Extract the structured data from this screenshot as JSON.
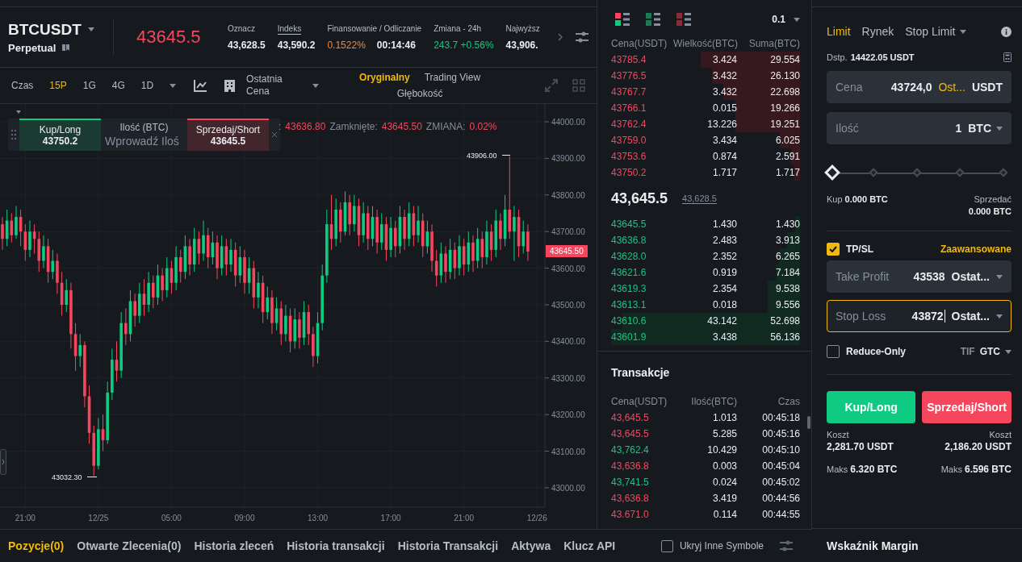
{
  "header": {
    "symbol": "BTCUSDT",
    "contract": "Perpetual",
    "last_price": "43645.5",
    "stats": [
      {
        "label": "Oznacz",
        "underlined": false,
        "values": [
          {
            "text": "43,628.5",
            "kind": "plain"
          }
        ]
      },
      {
        "label": "Indeks",
        "underlined": true,
        "values": [
          {
            "text": "43,590.2",
            "kind": "plain"
          }
        ]
      },
      {
        "label": "Finansowanie / Odliczanie",
        "underlined": false,
        "values": [
          {
            "text": "0.1522%",
            "kind": "rate"
          },
          {
            "text": "00:14:46",
            "kind": "plain"
          }
        ]
      },
      {
        "label": "Zmiana - 24h",
        "underlined": false,
        "values": [
          {
            "text": "243.7 +0.56%",
            "kind": "up"
          }
        ]
      },
      {
        "label": "Najwyższ",
        "underlined": false,
        "values": [
          {
            "text": "43,906.",
            "kind": "plain"
          }
        ]
      }
    ]
  },
  "toolbar": {
    "label": "Czas",
    "intervals": [
      {
        "label": "15P",
        "selected": true
      },
      {
        "label": "1G",
        "selected": false
      },
      {
        "label": "4G",
        "selected": false
      },
      {
        "label": "1D",
        "selected": false
      }
    ],
    "price_source": "Ostatnia Cena",
    "views": [
      {
        "label": "Oryginalny",
        "selected": true
      },
      {
        "label": "Trading View",
        "selected": false
      },
      {
        "label": "Głębokość",
        "selected": false
      }
    ]
  },
  "chart": {
    "chart_data": {
      "type": "candlestick",
      "categories": [
        null,
        null,
        null,
        null,
        null,
        "21:00",
        null,
        null,
        null,
        null,
        null,
        null,
        null,
        null,
        null,
        null,
        null,
        null,
        null,
        null,
        null,
        "12/25",
        null,
        null,
        null,
        null,
        null,
        null,
        null,
        null,
        null,
        null,
        null,
        null,
        null,
        null,
        null,
        "05:00",
        null,
        null,
        null,
        null,
        null,
        null,
        null,
        null,
        null,
        null,
        null,
        null,
        null,
        null,
        null,
        "09:00",
        null,
        null,
        null,
        null,
        null,
        null,
        null,
        null,
        null,
        null,
        null,
        null,
        null,
        null,
        null,
        "13:00",
        null,
        null,
        null,
        null,
        null,
        null,
        null,
        null,
        null,
        null,
        null,
        null,
        null,
        null,
        null,
        "17:00",
        null,
        null,
        null,
        null,
        null,
        null,
        null,
        null,
        null,
        null,
        null,
        null,
        null,
        null,
        null,
        "21:00",
        null,
        null,
        null,
        null,
        null,
        null,
        null,
        null,
        null,
        null,
        null,
        null,
        null,
        null,
        null,
        "12/26"
      ],
      "ohlc": [
        [
          43720,
          43740,
          43650,
          43680
        ],
        [
          43680,
          43760,
          43660,
          43730
        ],
        [
          43730,
          43750,
          43670,
          43690
        ],
        [
          43690,
          43770,
          43680,
          43740
        ],
        [
          43740,
          43760,
          43660,
          43700
        ],
        [
          43700,
          43720,
          43620,
          43650
        ],
        [
          43650,
          43730,
          43630,
          43700
        ],
        [
          43700,
          43720,
          43640,
          43680
        ],
        [
          43680,
          43700,
          43590,
          43620
        ],
        [
          43620,
          43690,
          43600,
          43660
        ],
        [
          43660,
          43680,
          43560,
          43590
        ],
        [
          43590,
          43650,
          43570,
          43620
        ],
        [
          43620,
          43640,
          43530,
          43560
        ],
        [
          43560,
          43590,
          43470,
          43500
        ],
        [
          43500,
          43570,
          43480,
          43540
        ],
        [
          43540,
          43560,
          43380,
          43420
        ],
        [
          43420,
          43450,
          43320,
          43360
        ],
        [
          43360,
          43420,
          43330,
          43390
        ],
        [
          43390,
          43400,
          43220,
          43250
        ],
        [
          43250,
          43280,
          43120,
          43150
        ],
        [
          43150,
          43170,
          43032.3,
          43060
        ],
        [
          43060,
          43190,
          43050,
          43160
        ],
        [
          43160,
          43200,
          43100,
          43130
        ],
        [
          43130,
          43290,
          43120,
          43260
        ],
        [
          43260,
          43380,
          43240,
          43350
        ],
        [
          43350,
          43400,
          43290,
          43320
        ],
        [
          43320,
          43480,
          43300,
          43450
        ],
        [
          43450,
          43490,
          43390,
          43420
        ],
        [
          43420,
          43540,
          43400,
          43510
        ],
        [
          43510,
          43530,
          43440,
          43470
        ],
        [
          43470,
          43560,
          43450,
          43530
        ],
        [
          43530,
          43570,
          43470,
          43500
        ],
        [
          43500,
          43590,
          43480,
          43560
        ],
        [
          43560,
          43580,
          43490,
          43520
        ],
        [
          43520,
          43610,
          43500,
          43580
        ],
        [
          43580,
          43600,
          43510,
          43540
        ],
        [
          43540,
          43630,
          43520,
          43600
        ],
        [
          43600,
          43620,
          43530,
          43560
        ],
        [
          43560,
          43660,
          43540,
          43630
        ],
        [
          43630,
          43650,
          43560,
          43590
        ],
        [
          43590,
          43690,
          43570,
          43660
        ],
        [
          43660,
          43680,
          43580,
          43610
        ],
        [
          43610,
          43710,
          43590,
          43680
        ],
        [
          43680,
          43700,
          43610,
          43640
        ],
        [
          43640,
          43730,
          43620,
          43690
        ],
        [
          43690,
          43710,
          43600,
          43630
        ],
        [
          43630,
          43700,
          43610,
          43670
        ],
        [
          43670,
          43690,
          43570,
          43600
        ],
        [
          43600,
          43690,
          43580,
          43660
        ],
        [
          43660,
          43680,
          43580,
          43610
        ],
        [
          43610,
          43680,
          43590,
          43650
        ],
        [
          43650,
          43670,
          43550,
          43580
        ],
        [
          43580,
          43660,
          43560,
          43630
        ],
        [
          43630,
          43650,
          43530,
          43560
        ],
        [
          43560,
          43630,
          43530,
          43600
        ],
        [
          43600,
          43620,
          43490,
          43520
        ],
        [
          43520,
          43590,
          43490,
          43560
        ],
        [
          43560,
          43580,
          43450,
          43480
        ],
        [
          43480,
          43550,
          43460,
          43520
        ],
        [
          43520,
          43540,
          43420,
          43450
        ],
        [
          43450,
          43520,
          43430,
          43490
        ],
        [
          43490,
          43510,
          43390,
          43420
        ],
        [
          43420,
          43500,
          43400,
          43470
        ],
        [
          43470,
          43490,
          43370,
          43400
        ],
        [
          43400,
          43490,
          43380,
          43460
        ],
        [
          43460,
          43480,
          43380,
          43410
        ],
        [
          43410,
          43510,
          43390,
          43480
        ],
        [
          43480,
          43500,
          43390,
          43420
        ],
        [
          43420,
          43440,
          43330,
          43360
        ],
        [
          43360,
          43480,
          43340,
          43450
        ],
        [
          43450,
          43610,
          43430,
          43580
        ],
        [
          43580,
          43760,
          43560,
          43720
        ],
        [
          43720,
          43800,
          43650,
          43680
        ],
        [
          43680,
          43790,
          43660,
          43760
        ],
        [
          43760,
          43780,
          43670,
          43700
        ],
        [
          43700,
          43810,
          43690,
          43780
        ],
        [
          43780,
          43800,
          43690,
          43720
        ],
        [
          43720,
          43800,
          43700,
          43770
        ],
        [
          43770,
          43790,
          43660,
          43690
        ],
        [
          43690,
          43780,
          43670,
          43750
        ],
        [
          43750,
          43770,
          43650,
          43680
        ],
        [
          43680,
          43770,
          43660,
          43740
        ],
        [
          43740,
          43760,
          43640,
          43670
        ],
        [
          43670,
          43750,
          43650,
          43720
        ],
        [
          43720,
          43740,
          43620,
          43650
        ],
        [
          43650,
          43740,
          43630,
          43710
        ],
        [
          43710,
          43730,
          43630,
          43660
        ],
        [
          43660,
          43770,
          43640,
          43740
        ],
        [
          43740,
          43760,
          43650,
          43680
        ],
        [
          43680,
          43780,
          43660,
          43750
        ],
        [
          43750,
          43770,
          43660,
          43690
        ],
        [
          43690,
          43770,
          43670,
          43730
        ],
        [
          43730,
          43750,
          43630,
          43660
        ],
        [
          43660,
          43730,
          43640,
          43700
        ],
        [
          43700,
          43720,
          43590,
          43620
        ],
        [
          43620,
          43650,
          43550,
          43580
        ],
        [
          43580,
          43670,
          43560,
          43640
        ],
        [
          43640,
          43660,
          43560,
          43590
        ],
        [
          43590,
          43680,
          43570,
          43650
        ],
        [
          43650,
          43670,
          43570,
          43600
        ],
        [
          43600,
          43690,
          43580,
          43660
        ],
        [
          43660,
          43680,
          43580,
          43610
        ],
        [
          43610,
          43700,
          43590,
          43670
        ],
        [
          43670,
          43690,
          43590,
          43620
        ],
        [
          43620,
          43710,
          43600,
          43680
        ],
        [
          43680,
          43700,
          43600,
          43630
        ],
        [
          43630,
          43730,
          43610,
          43700
        ],
        [
          43700,
          43720,
          43620,
          43650
        ],
        [
          43650,
          43760,
          43630,
          43730
        ],
        [
          43730,
          43750,
          43650,
          43680
        ],
        [
          43680,
          43800,
          43660,
          43760
        ],
        [
          43760,
          43906,
          43680,
          43700
        ],
        [
          43700,
          43770,
          43620,
          43740
        ],
        [
          43740,
          43760,
          43630,
          43660
        ],
        [
          43660,
          43730,
          43640,
          43700
        ],
        [
          43700,
          43720,
          43620,
          43645.5
        ],
        null,
        null
      ],
      "ylim": [
        42947,
        44048.5
      ],
      "grid": true,
      "yticks": [
        {
          "value": 44000,
          "label": "44000.00"
        },
        {
          "value": 43900,
          "label": "43900.00"
        },
        {
          "value": 43800,
          "label": "43800.00"
        },
        {
          "value": 43700,
          "label": "43700.00"
        },
        {
          "value": 43600,
          "label": "43600.00"
        },
        {
          "value": 43500,
          "label": "43500.00"
        },
        {
          "value": 43400,
          "label": "43400.00"
        },
        {
          "value": 43300,
          "label": "43300.00"
        },
        {
          "value": 43200,
          "label": "43200.00"
        },
        {
          "value": 43100,
          "label": "43100.00"
        },
        {
          "value": 43000,
          "label": "43000.00"
        }
      ]
    },
    "current_price": "43645.50",
    "high_marker": "43906.00",
    "low_marker": "43032.30",
    "quick_trade": {
      "buy_label": "Kup/Long",
      "buy_price": "43750.2",
      "qty_label": "Ilość (BTC)",
      "qty_placeholder": "Wprowadź Iloś",
      "sell_label": "Sprzedaj/Short",
      "sell_price": "43645.5"
    },
    "ohlc": [
      {
        "label": ":",
        "value": "43636.80"
      },
      {
        "label": "Zamknięte:",
        "value": "43645.50"
      },
      {
        "label": "ZMIANA:",
        "value": "0.02%"
      }
    ]
  },
  "order_book": {
    "precision": "0.1",
    "columns": [
      "Cena(USDT)",
      "Wielkość(BTC)",
      "Suma(BTC)"
    ],
    "asks": [
      {
        "price": "43785.4",
        "size": "3.424",
        "sum": "29.554"
      },
      {
        "price": "43776.5",
        "size": "3.432",
        "sum": "26.130"
      },
      {
        "price": "43767.7",
        "size": "3.432",
        "sum": "22.698"
      },
      {
        "price": "43766.1",
        "size": "0.015",
        "sum": "19.266"
      },
      {
        "price": "43762.4",
        "size": "13.226",
        "sum": "19.251"
      },
      {
        "price": "43759.0",
        "size": "3.434",
        "sum": "6.025"
      },
      {
        "price": "43753.6",
        "size": "0.874",
        "sum": "2.591"
      },
      {
        "price": "43750.2",
        "size": "1.717",
        "sum": "1.717"
      }
    ],
    "mid_price": "43,645.5",
    "mark_price": "43,628.5",
    "bids": [
      {
        "price": "43645.5",
        "size": "1.430",
        "sum": "1.430"
      },
      {
        "price": "43636.8",
        "size": "2.483",
        "sum": "3.913"
      },
      {
        "price": "43628.0",
        "size": "2.352",
        "sum": "6.265"
      },
      {
        "price": "43621.6",
        "size": "0.919",
        "sum": "7.184"
      },
      {
        "price": "43619.3",
        "size": "2.354",
        "sum": "9.538"
      },
      {
        "price": "43613.1",
        "size": "0.018",
        "sum": "9.556"
      },
      {
        "price": "43610.6",
        "size": "43.142",
        "sum": "52.698"
      },
      {
        "price": "43601.9",
        "size": "3.438",
        "sum": "56.136"
      }
    ]
  },
  "trades": {
    "title": "Transakcje",
    "columns": [
      "Cena(USDT)",
      "Ilość(BTC)",
      "Czas"
    ],
    "rows": [
      {
        "price": "43,645.5",
        "size": "1.013",
        "time": "00:45:18",
        "color": "#f6465d"
      },
      {
        "price": "43,645.5",
        "size": "5.285",
        "time": "00:45:16",
        "color": "#f6465d"
      },
      {
        "price": "43,762.4",
        "size": "10.429",
        "time": "00:45:10",
        "color": "#0ecb81"
      },
      {
        "price": "43,636.8",
        "size": "0.003",
        "time": "00:45:04",
        "color": "#f6465d"
      },
      {
        "price": "43,741.5",
        "size": "0.024",
        "time": "00:45:02",
        "color": "#0ecb81"
      },
      {
        "price": "43,636.8",
        "size": "3.419",
        "time": "00:44:56",
        "color": "#f6465d"
      },
      {
        "price": "43.671.0",
        "size": "0.114",
        "time": "00:44:55",
        "color": "#f6465d"
      }
    ]
  },
  "order_form": {
    "tabs": [
      {
        "label": "Limit",
        "selected": true,
        "has_menu": false
      },
      {
        "label": "Rynek",
        "selected": false,
        "has_menu": false
      },
      {
        "label": "Stop Limit",
        "selected": false,
        "has_menu": true
      }
    ],
    "available_label": "Dstp.",
    "available": "14422.05 USDT",
    "price_field": {
      "label": "Cena",
      "value": "43724,0",
      "source": "Ost...",
      "unit": "USDT"
    },
    "qty_field": {
      "label": "Ilość",
      "value": "1",
      "unit": "BTC"
    },
    "slider": {
      "level": 0
    },
    "buy_amount": {
      "label": "Kup",
      "value": "0.000 BTC"
    },
    "sell_amount": {
      "label": "Sprzedać",
      "value": "0.000 BTC"
    },
    "tpsl": {
      "label": "TP/SL",
      "checked": true,
      "advanced": "Zaawansowane"
    },
    "tp_fields": [
      {
        "label": "Take Profit",
        "value": "43538",
        "source": "Ostat...",
        "focused": false
      },
      {
        "label": "Stop Loss",
        "value": "43872",
        "source": "Ostat...",
        "focused": true
      }
    ],
    "reduce_only": {
      "label": "Reduce-Only",
      "checked": false
    },
    "tif": {
      "label": "TIF",
      "value": "GTC"
    },
    "buy_button": "Kup/Long",
    "sell_button": "Sprzedaj/Short",
    "costs": [
      {
        "label": "Koszt",
        "value": "2,281.70 USDT",
        "max_label": "Maks",
        "max": "6.320 BTC"
      },
      {
        "label": "Koszt",
        "value": "2,186.20 USDT",
        "max_label": "Maks",
        "max": "6.596 BTC"
      }
    ],
    "margin_title": "Wskaźnik Margin"
  },
  "bottom": {
    "tabs": [
      {
        "label": "Pozycje(0)",
        "selected": true
      },
      {
        "label": "Otwarte Zlecenia(0)",
        "selected": false
      },
      {
        "label": "Historia zleceń",
        "selected": false
      },
      {
        "label": "Historia transakcji",
        "selected": false
      },
      {
        "label": "Historia Transakcji",
        "selected": false
      },
      {
        "label": "Aktywa",
        "selected": false
      },
      {
        "label": "Klucz API",
        "selected": false
      }
    ],
    "hide_others": {
      "label": "Ukryj Inne Symbole",
      "checked": false
    }
  }
}
